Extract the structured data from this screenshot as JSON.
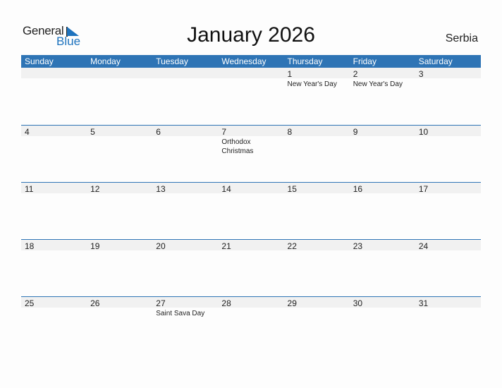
{
  "logo": {
    "general": "General",
    "blue": "Blue"
  },
  "title": "January 2026",
  "country": "Serbia",
  "colors": {
    "accent": "#2e74b5",
    "band": "#f1f1f1"
  },
  "weekdays": [
    "Sunday",
    "Monday",
    "Tuesday",
    "Wednesday",
    "Thursday",
    "Friday",
    "Saturday"
  ],
  "weeks": [
    [
      {
        "day": "",
        "event": ""
      },
      {
        "day": "",
        "event": ""
      },
      {
        "day": "",
        "event": ""
      },
      {
        "day": "",
        "event": ""
      },
      {
        "day": "1",
        "event": "New Year's Day"
      },
      {
        "day": "2",
        "event": "New Year's Day"
      },
      {
        "day": "3",
        "event": ""
      }
    ],
    [
      {
        "day": "4",
        "event": ""
      },
      {
        "day": "5",
        "event": ""
      },
      {
        "day": "6",
        "event": ""
      },
      {
        "day": "7",
        "event": "Orthodox Christmas"
      },
      {
        "day": "8",
        "event": ""
      },
      {
        "day": "9",
        "event": ""
      },
      {
        "day": "10",
        "event": ""
      }
    ],
    [
      {
        "day": "11",
        "event": ""
      },
      {
        "day": "12",
        "event": ""
      },
      {
        "day": "13",
        "event": ""
      },
      {
        "day": "14",
        "event": ""
      },
      {
        "day": "15",
        "event": ""
      },
      {
        "day": "16",
        "event": ""
      },
      {
        "day": "17",
        "event": ""
      }
    ],
    [
      {
        "day": "18",
        "event": ""
      },
      {
        "day": "19",
        "event": ""
      },
      {
        "day": "20",
        "event": ""
      },
      {
        "day": "21",
        "event": ""
      },
      {
        "day": "22",
        "event": ""
      },
      {
        "day": "23",
        "event": ""
      },
      {
        "day": "24",
        "event": ""
      }
    ],
    [
      {
        "day": "25",
        "event": ""
      },
      {
        "day": "26",
        "event": ""
      },
      {
        "day": "27",
        "event": "Saint Sava Day"
      },
      {
        "day": "28",
        "event": ""
      },
      {
        "day": "29",
        "event": ""
      },
      {
        "day": "30",
        "event": ""
      },
      {
        "day": "31",
        "event": ""
      }
    ]
  ]
}
